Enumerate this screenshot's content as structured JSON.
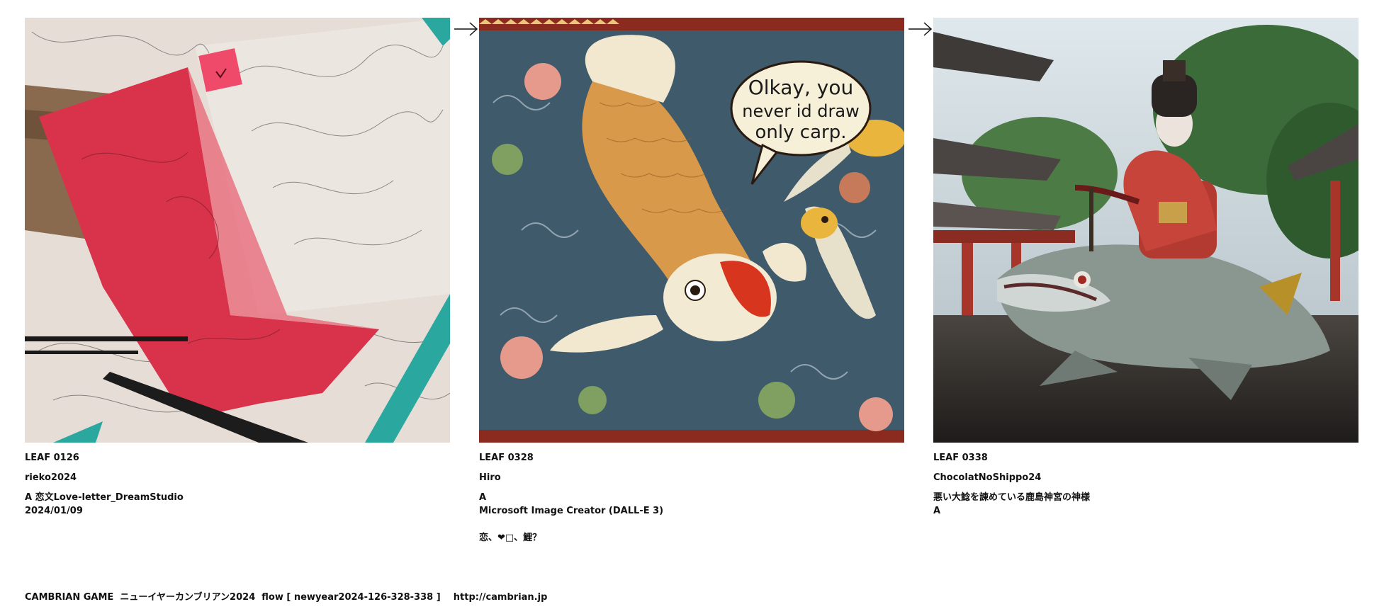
{
  "flow": {
    "arrow_icon": "right-arrow-icon",
    "leaves": [
      {
        "code": "LEAF 0126",
        "author": "rieko2024",
        "lines": [
          "A 恋文Love-letter_DreamStudio",
          "2024/01/09"
        ],
        "image": "red folded love letter on a sketched paper desk with pencils"
      },
      {
        "code": "LEAF 0328",
        "author": "Hiro",
        "lines": [
          "A",
          "Microsoft Image Creator (DALL-E 3)",
          "",
          "恋、❤□、鯉？"
        ],
        "image": "ornate koi illustration with speech bubble",
        "speech_bubble": [
          "Olkay, you",
          "never id draw",
          "only carp."
        ]
      },
      {
        "code": "LEAF 0338",
        "author": "ChocolatNoShippo24",
        "lines": [
          "悪い大鯰を諌めている鹿島神宮の神様",
          "A"
        ],
        "image": "kimono-clad figure riding a giant catfish statue before a shrine"
      }
    ]
  },
  "footer": {
    "text": "CAMBRIAN GAME  ニューイヤーカンブリアン2024  flow [ newyear2024-126-328-338 ]    http://cambrian.jp"
  }
}
